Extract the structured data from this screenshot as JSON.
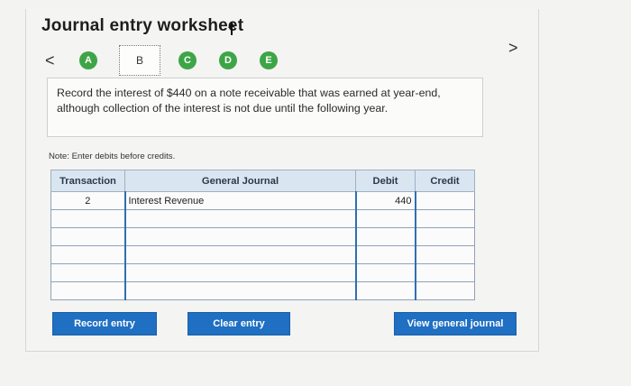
{
  "header": {
    "title": "Journal entry worksheet"
  },
  "nav": {
    "prev": "<",
    "next": ">",
    "steps": [
      {
        "label": "A",
        "state": "complete"
      },
      {
        "label": "B",
        "state": "current"
      },
      {
        "label": "C",
        "state": "complete"
      },
      {
        "label": "D",
        "state": "complete"
      },
      {
        "label": "E",
        "state": "complete"
      }
    ]
  },
  "prompt": {
    "text": "Record the interest of $440 on a note receivable that was earned at year-end, although collection of the interest is not due until the following year."
  },
  "note": "Note: Enter debits before credits.",
  "table": {
    "headers": {
      "transaction": "Transaction",
      "general_journal": "General Journal",
      "debit": "Debit",
      "credit": "Credit"
    },
    "rows": [
      {
        "transaction": "2",
        "account": "Interest Revenue",
        "debit": "440",
        "credit": ""
      },
      {
        "transaction": "",
        "account": "",
        "debit": "",
        "credit": ""
      },
      {
        "transaction": "",
        "account": "",
        "debit": "",
        "credit": ""
      },
      {
        "transaction": "",
        "account": "",
        "debit": "",
        "credit": ""
      },
      {
        "transaction": "",
        "account": "",
        "debit": "",
        "credit": ""
      },
      {
        "transaction": "",
        "account": "",
        "debit": "",
        "credit": ""
      }
    ]
  },
  "buttons": {
    "record": "Record entry",
    "clear": "Clear entry",
    "view": "View general journal"
  },
  "colors": {
    "accent": "#1f6fc2",
    "step_green": "#3ea547",
    "header_bg": "#d9e6f1"
  }
}
